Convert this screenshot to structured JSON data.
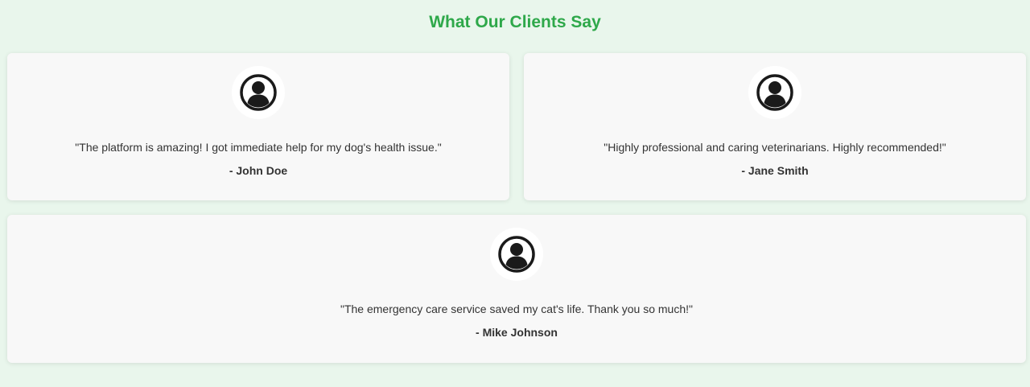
{
  "section": {
    "title": "What Our Clients Say",
    "title_color": "#2ea84a",
    "background_color": "#e9f6ec"
  },
  "testimonials": [
    {
      "quote": "\"The platform is amazing! I got immediate help for my dog's health issue.\"",
      "author": "- John Doe",
      "icon": "user-avatar-icon"
    },
    {
      "quote": "\"Highly professional and caring veterinarians. Highly recommended!\"",
      "author": "- Jane Smith",
      "icon": "user-avatar-icon"
    },
    {
      "quote": "\"The emergency care service saved my cat's life. Thank you so much!\"",
      "author": "- Mike Johnson",
      "icon": "user-avatar-icon"
    }
  ]
}
